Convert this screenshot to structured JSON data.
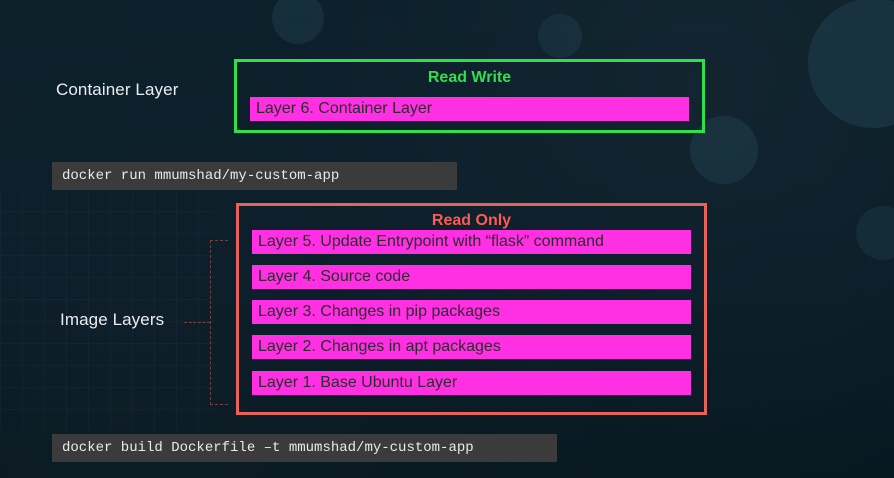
{
  "labels": {
    "container_layer": "Container Layer",
    "image_layers": "Image Layers"
  },
  "commands": {
    "run": "docker run mmumshad/my-custom-app",
    "build": "docker build Dockerfile –t mmumshad/my-custom-app"
  },
  "read_write_box": {
    "title": "Read Write",
    "layer_6": "Layer 6. Container Layer"
  },
  "read_only_box": {
    "title": "Read Only",
    "layers": [
      "Layer 5. Update Entrypoint with “flask” command",
      "Layer 4. Source code",
      "Layer 3. Changes in pip packages",
      "Layer 2. Changes in apt packages",
      "Layer 1. Base Ubuntu Layer"
    ]
  },
  "colors": {
    "read_write_border": "#2fe04c",
    "read_only_border": "#e6625b",
    "layer_fill": "#ff2fe3",
    "command_bar": "#3b3b3b",
    "background": "#0b1f2a"
  }
}
